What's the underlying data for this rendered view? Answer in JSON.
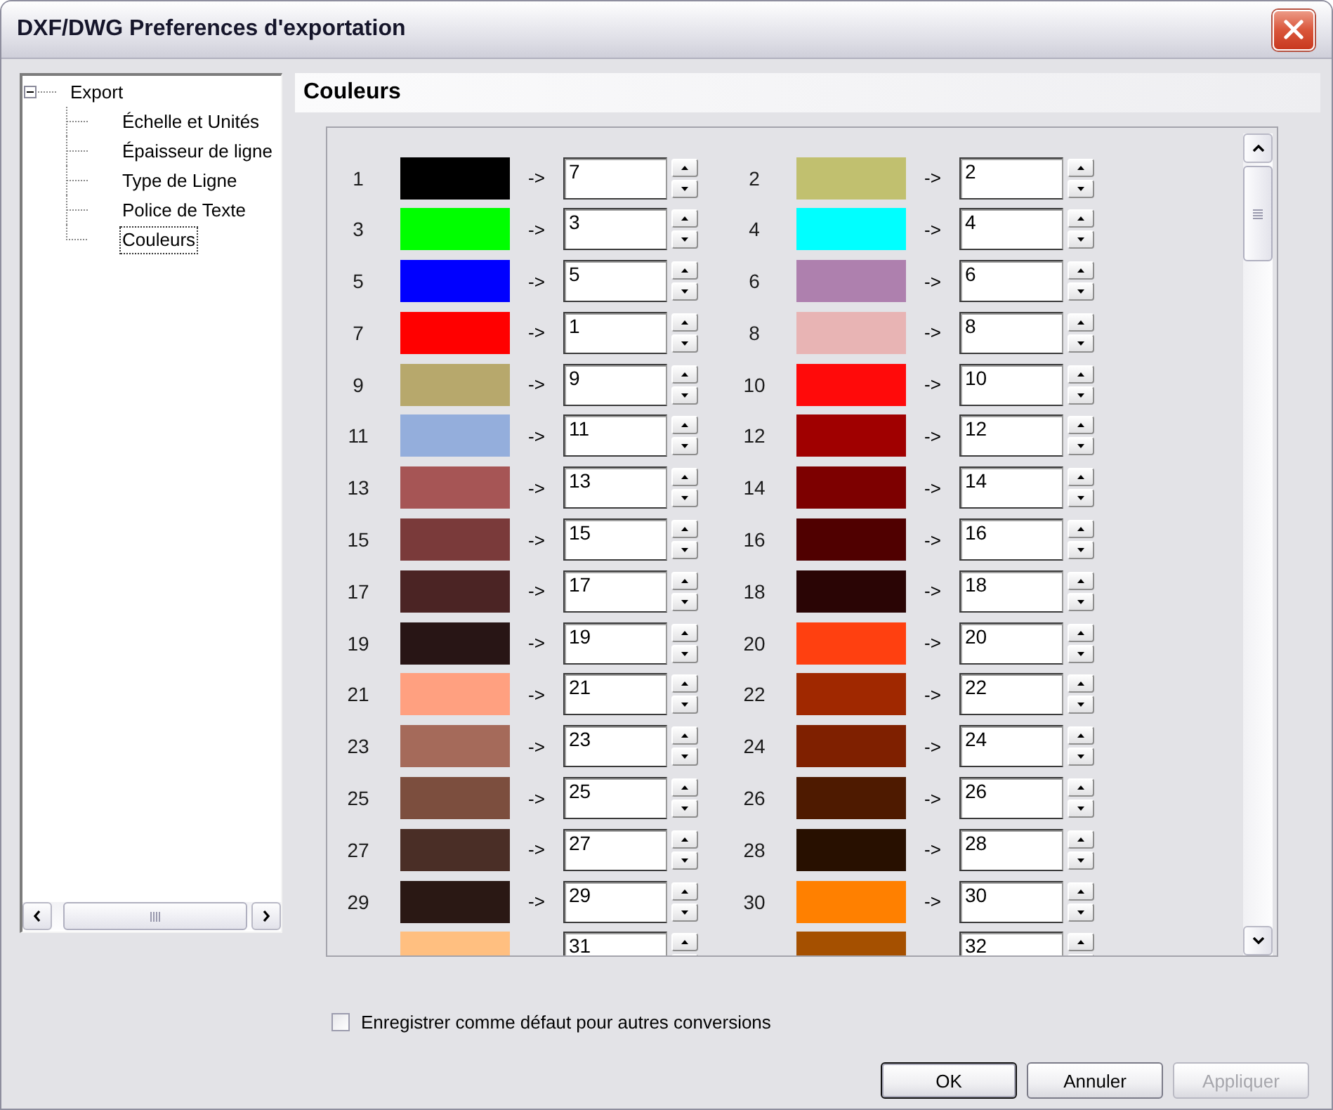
{
  "window": {
    "title": "DXF/DWG Preferences d'exportation"
  },
  "tree": {
    "items": [
      {
        "label": "Export",
        "expanded": true,
        "selected": false,
        "children": [
          {
            "label": "Échelle et Unités",
            "selected": false
          },
          {
            "label": "Épaisseur de ligne",
            "selected": false
          },
          {
            "label": "Type de Ligne",
            "selected": false
          },
          {
            "label": "Police de Texte",
            "selected": false
          },
          {
            "label": "Couleurs",
            "selected": true
          }
        ]
      }
    ]
  },
  "panel": {
    "title": "Couleurs",
    "colors": [
      {
        "index": "1",
        "color": "#000000",
        "arrow": "->",
        "value": "7"
      },
      {
        "index": "2",
        "color": "#c1c06f",
        "arrow": "->",
        "value": "2"
      },
      {
        "index": "3",
        "color": "#00ff00",
        "arrow": "->",
        "value": "3"
      },
      {
        "index": "4",
        "color": "#00ffff",
        "arrow": "->",
        "value": "4"
      },
      {
        "index": "5",
        "color": "#0000ff",
        "arrow": "->",
        "value": "5"
      },
      {
        "index": "6",
        "color": "#ae80ae",
        "arrow": "->",
        "value": "6"
      },
      {
        "index": "7",
        "color": "#ff0000",
        "arrow": "->",
        "value": "1"
      },
      {
        "index": "8",
        "color": "#e8b4b4",
        "arrow": "->",
        "value": "8"
      },
      {
        "index": "9",
        "color": "#b7a86c",
        "arrow": "->",
        "value": "9"
      },
      {
        "index": "10",
        "color": "#ff0a0a",
        "arrow": "->",
        "value": "10"
      },
      {
        "index": "11",
        "color": "#94aedc",
        "arrow": "->",
        "value": "11"
      },
      {
        "index": "12",
        "color": "#a00000",
        "arrow": "->",
        "value": "12"
      },
      {
        "index": "13",
        "color": "#a65555",
        "arrow": "->",
        "value": "13"
      },
      {
        "index": "14",
        "color": "#7d0000",
        "arrow": "->",
        "value": "14"
      },
      {
        "index": "15",
        "color": "#7a3a3a",
        "arrow": "->",
        "value": "15"
      },
      {
        "index": "16",
        "color": "#500000",
        "arrow": "->",
        "value": "16"
      },
      {
        "index": "17",
        "color": "#4b2424",
        "arrow": "->",
        "value": "17"
      },
      {
        "index": "18",
        "color": "#2a0505",
        "arrow": "->",
        "value": "18"
      },
      {
        "index": "19",
        "color": "#281515",
        "arrow": "->",
        "value": "19"
      },
      {
        "index": "20",
        "color": "#ff4010",
        "arrow": "->",
        "value": "20"
      },
      {
        "index": "21",
        "color": "#ffa080",
        "arrow": "->",
        "value": "21"
      },
      {
        "index": "22",
        "color": "#a02800",
        "arrow": "->",
        "value": "22"
      },
      {
        "index": "23",
        "color": "#a56a5a",
        "arrow": "->",
        "value": "23"
      },
      {
        "index": "24",
        "color": "#7f2000",
        "arrow": "->",
        "value": "24"
      },
      {
        "index": "25",
        "color": "#7c4e3e",
        "arrow": "->",
        "value": "25"
      },
      {
        "index": "26",
        "color": "#4e1a00",
        "arrow": "->",
        "value": "26"
      },
      {
        "index": "27",
        "color": "#4a2e26",
        "arrow": "->",
        "value": "27"
      },
      {
        "index": "28",
        "color": "#281000",
        "arrow": "->",
        "value": "28"
      },
      {
        "index": "29",
        "color": "#2a1814",
        "arrow": "->",
        "value": "29"
      },
      {
        "index": "30",
        "color": "#ff8000",
        "arrow": "->",
        "value": "30"
      },
      {
        "color": "#ffbf80",
        "value": "31"
      },
      {
        "color": "#a55000",
        "value": "32"
      }
    ]
  },
  "save_default": {
    "label": "Enregistrer comme défaut pour autres conversions",
    "checked": false
  },
  "buttons": [
    {
      "label": "OK",
      "default": true,
      "disabled": false
    },
    {
      "label": "Annuler",
      "default": false,
      "disabled": false
    },
    {
      "label": "Appliquer",
      "default": false,
      "disabled": true
    }
  ]
}
